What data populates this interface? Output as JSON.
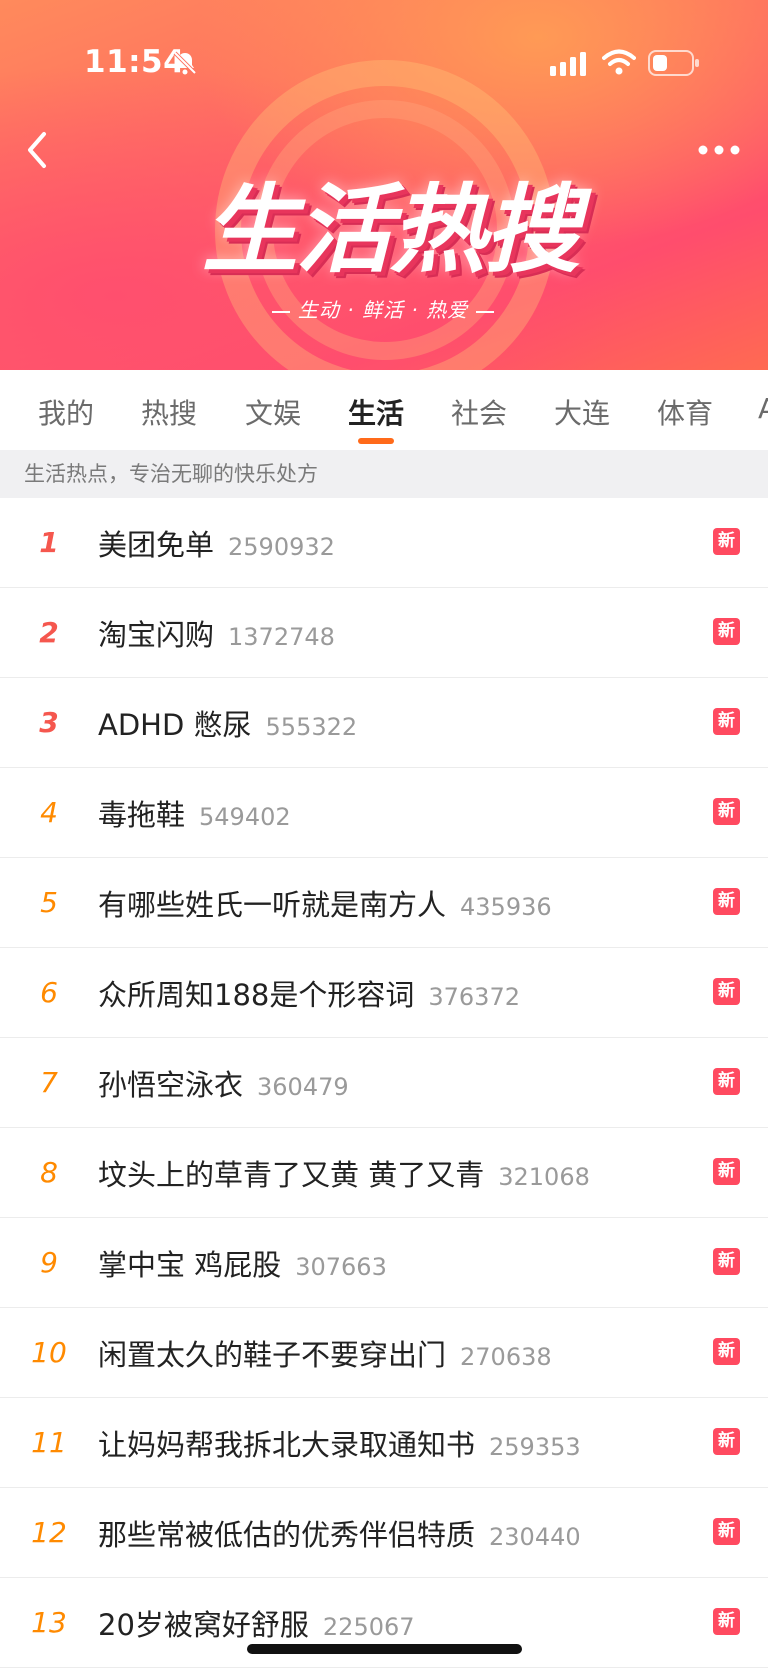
{
  "status_bar": {
    "time": "11:54"
  },
  "banner": {
    "title": "生活热搜",
    "subtitle": "生动 · 鲜活 · 热爱"
  },
  "tabs": [
    {
      "label": "我的"
    },
    {
      "label": "热搜"
    },
    {
      "label": "文娱"
    },
    {
      "label": "生活",
      "active": true
    },
    {
      "label": "社会"
    },
    {
      "label": "大连"
    },
    {
      "label": "体育"
    },
    {
      "label": "A"
    }
  ],
  "hint": "生活热点，专治无聊的快乐处方",
  "badge_label": "新",
  "items": [
    {
      "rank": "1",
      "title": "美团免单",
      "count": "2590932"
    },
    {
      "rank": "2",
      "title": "淘宝闪购",
      "count": "1372748"
    },
    {
      "rank": "3",
      "title": "ADHD 憋尿",
      "count": "555322"
    },
    {
      "rank": "4",
      "title": "毒拖鞋",
      "count": "549402"
    },
    {
      "rank": "5",
      "title": "有哪些姓氏一听就是南方人",
      "count": "435936"
    },
    {
      "rank": "6",
      "title": "众所周知188是个形容词",
      "count": "376372"
    },
    {
      "rank": "7",
      "title": "孙悟空泳衣",
      "count": "360479"
    },
    {
      "rank": "8",
      "title": "坟头上的草青了又黄 黄了又青",
      "count": "321068"
    },
    {
      "rank": "9",
      "title": "掌中宝 鸡屁股",
      "count": "307663"
    },
    {
      "rank": "10",
      "title": "闲置太久的鞋子不要穿出门",
      "count": "270638"
    },
    {
      "rank": "11",
      "title": "让妈妈帮我拆北大录取通知书",
      "count": "259353"
    },
    {
      "rank": "12",
      "title": "那些常被低估的优秀伴侣特质",
      "count": "230440"
    },
    {
      "rank": "13",
      "title": "20岁被窝好舒服",
      "count": "225067"
    }
  ],
  "colors": {
    "accent": "#ff6a1a",
    "badge": "#ff4a60",
    "rank_top": "#f5574e",
    "rank": "#ff8a00"
  }
}
